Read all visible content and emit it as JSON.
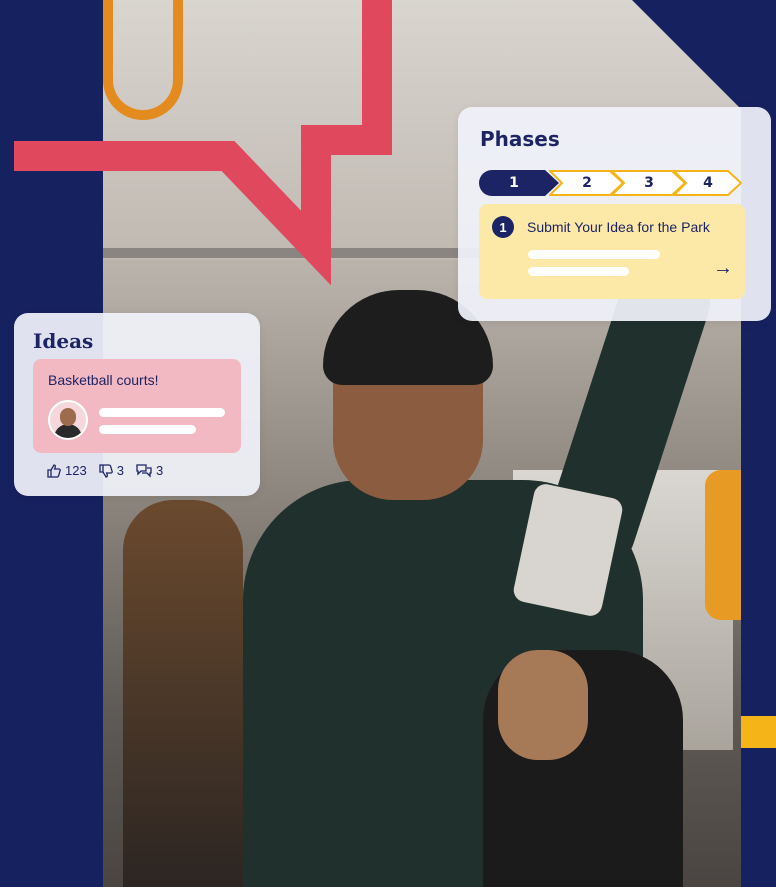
{
  "phases_card": {
    "title": "Phases",
    "steps": [
      "1",
      "2",
      "3",
      "4"
    ],
    "active_step": "1",
    "task": {
      "number": "1",
      "title": "Submit Your Idea for the Park",
      "arrow_icon": "arrow-right-icon"
    }
  },
  "ideas_card": {
    "title": "Ideas",
    "idea": {
      "title": "Basketball courts!",
      "avatar_icon": "user-avatar"
    },
    "stats": {
      "likes": "123",
      "dislikes": "3",
      "comments": "3",
      "like_icon": "thumbs-up-icon",
      "dislike_icon": "thumbs-down-icon",
      "comment_icon": "comments-icon"
    }
  },
  "colors": {
    "background": "#16215f",
    "accent_red": "#e0485e",
    "accent_yellow": "#f5b417",
    "navy": "#1c2466",
    "task_bg": "#fde9a7",
    "idea_bg": "#f2b9c2"
  }
}
